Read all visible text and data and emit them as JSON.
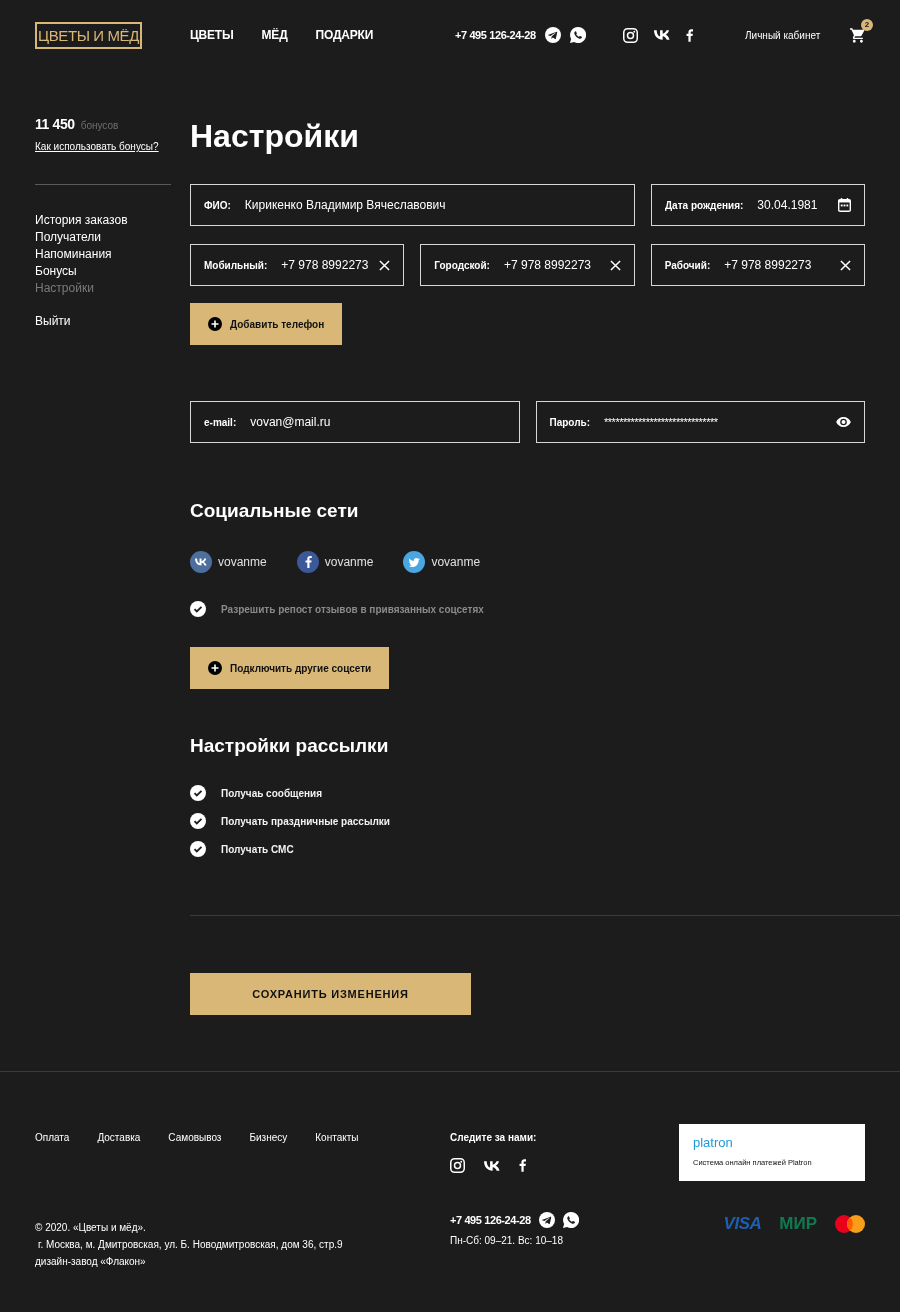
{
  "header": {
    "logo": "ЦВЕТЫ И МЁД",
    "nav": [
      "ЦВЕТЫ",
      "МЁД",
      "ПОДАРКИ"
    ],
    "phone": "+7 495 126-24-28",
    "account_link": "Личный кабинет",
    "cart_count": "2"
  },
  "sidebar": {
    "bonus_amount": "11 450",
    "bonus_unit": "бонусов",
    "bonus_link": "Как использовать бонусы?",
    "menu": [
      {
        "label": "История заказов",
        "selected": false
      },
      {
        "label": "Получатели",
        "selected": false
      },
      {
        "label": "Напоминания",
        "selected": false
      },
      {
        "label": "Бонусы",
        "selected": false
      },
      {
        "label": "Настройки",
        "selected": true
      }
    ],
    "logout": "Выйти"
  },
  "title": "Настройки",
  "personal_fields": [
    {
      "kind": "text",
      "label": "ФИО:",
      "value": "Кирикенко Владимир Вячеславович"
    },
    {
      "kind": "date",
      "label": "Дата рождения:",
      "value": "30.04.1981"
    }
  ],
  "phone_fields": [
    {
      "kind": "phone",
      "label": "Мобильный:",
      "value": "+7 978 8992273"
    },
    {
      "kind": "phone",
      "label": "Городской:",
      "value": "+7 978 8992273"
    },
    {
      "kind": "phone",
      "label": "Рабочий:",
      "value": "+7 978 8992273"
    }
  ],
  "add_phone_button": "Добавить телефон",
  "account_fields": [
    {
      "kind": "text",
      "label": "e-mail:",
      "value": "vovan@mail.ru"
    },
    {
      "kind": "password",
      "label": "Пароль:",
      "value": "******************************"
    }
  ],
  "social": {
    "title": "Социальные сети",
    "accounts": [
      {
        "kind": "vk",
        "name": "vovanme",
        "color": "#4c6f9e"
      },
      {
        "kind": "facebook",
        "name": "vovanme",
        "color": "#3b5998"
      },
      {
        "kind": "twitter",
        "name": "vovanme",
        "color": "#4aa6e0"
      }
    ],
    "repost_option": {
      "label": "Разрешить репост отзывов в привязанных соцсетях",
      "checked": true
    },
    "connect_button": "Подключить другие соцсети"
  },
  "mailing": {
    "title": "Настройки рассылки",
    "options": [
      {
        "label": "Получаь сообщения",
        "checked": true
      },
      {
        "label": "Получать праздничные рассылки",
        "checked": true
      },
      {
        "label": "Получать СМС",
        "checked": true
      }
    ]
  },
  "save_button": "СОХРАНИТЬ ИЗМЕНЕНИЯ",
  "footer": {
    "links": [
      "Оплата",
      "Доставка",
      "Самовывоз",
      "Бизнесу",
      "Контакты"
    ],
    "follow_label": "Следите за нами:",
    "payment_provider": {
      "logo": "platron",
      "caption": "Система онлайн платежей Platron"
    },
    "copyright": "© 2020. «Цветы и мёд».",
    "address": "г. Москва, м. Дмитровская, ул. Б. Новодмитровская, дом 36, стр.9",
    "credit": "дизайн-завод «Флакон»",
    "phone": "+7 495 126-24-28",
    "hours": "Пн-Сб: 09–21. Вс: 10–18",
    "payment_logos": [
      {
        "kind": "visa",
        "label": "VISA"
      },
      {
        "kind": "mir",
        "label": "МИР"
      },
      {
        "kind": "mastercard"
      }
    ]
  }
}
